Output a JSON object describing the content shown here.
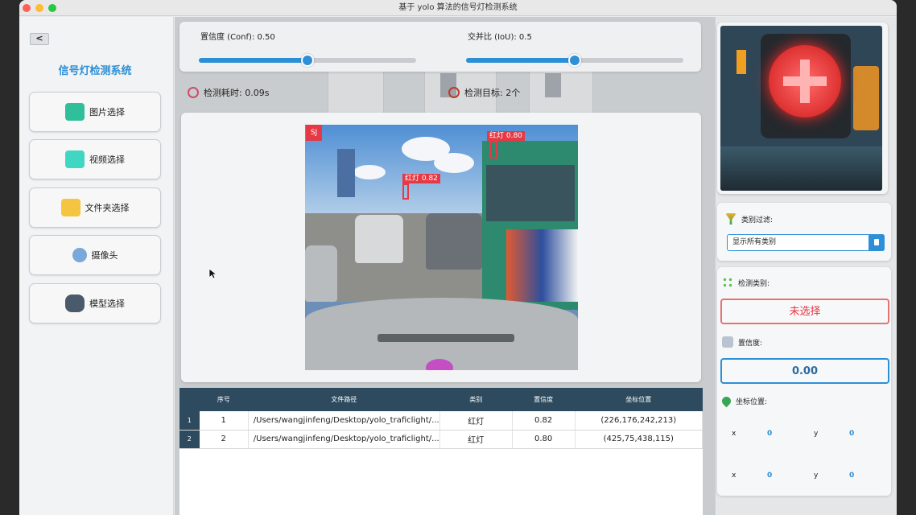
{
  "window": {
    "title": "基于 yolo 算法的信号灯检测系统"
  },
  "sidebar": {
    "back_label": "<",
    "title": "信号灯检测系统",
    "buttons": [
      {
        "label": "图片选择",
        "icon": "image-icon",
        "color": "#2fbf9a"
      },
      {
        "label": "视频选择",
        "icon": "clapperboard-icon",
        "color": "#3fd6c2"
      },
      {
        "label": "文件夹选择",
        "icon": "folder-icon",
        "color": "#f5c542"
      },
      {
        "label": "摄像头",
        "icon": "webcam-icon",
        "color": "#7aa8d8"
      },
      {
        "label": "模型选择",
        "icon": "model-icon",
        "color": "#4a5a6a"
      }
    ]
  },
  "controls": {
    "conf_label": "置信度 (Conf): 0.50",
    "conf_value": 0.5,
    "iou_label": "交并比 (IoU): 0.5",
    "iou_value": 0.5
  },
  "stats": {
    "time_label": "检测耗时: 0.09s",
    "targets_label": "检测目标: 2个"
  },
  "detections_overlay": [
    {
      "label": "红灯 0.80"
    },
    {
      "label": "红灯 0.82"
    }
  ],
  "overlay_tag": "SJ",
  "table": {
    "headers": [
      "序号",
      "文件路径",
      "类别",
      "置信度",
      "坐标位置"
    ],
    "rows": [
      {
        "row_head": "1",
        "index": "1",
        "path": "/Users/wangjinfeng/Desktop/yolo_traficlight/...",
        "class": "红灯",
        "conf": "0.82",
        "coords": "(226,176,242,213)"
      },
      {
        "row_head": "2",
        "index": "2",
        "path": "/Users/wangjinfeng/Desktop/yolo_traficlight/...",
        "class": "红灯",
        "conf": "0.80",
        "coords": "(425,75,438,115)"
      }
    ]
  },
  "right_panel": {
    "filter_label": "类别过滤:",
    "filter_value": "显示所有类别",
    "class_label": "检测类别:",
    "class_value": "未选择",
    "conf_label": "置信度:",
    "conf_value": "0.00",
    "coord_label": "坐标位置:",
    "coords": [
      {
        "x_label": "x",
        "x": "0",
        "y_label": "y",
        "y": "0"
      },
      {
        "x_label": "x",
        "x": "0",
        "y_label": "y",
        "y": "0"
      }
    ]
  },
  "colors": {
    "accent": "#2d8fd5",
    "class_value_text": "#e53945",
    "class_value_border": "#e57373",
    "conf_value_text": "#2d6aa0",
    "conf_value_border": "#2d8fd5",
    "detection_box": "#e53945"
  }
}
